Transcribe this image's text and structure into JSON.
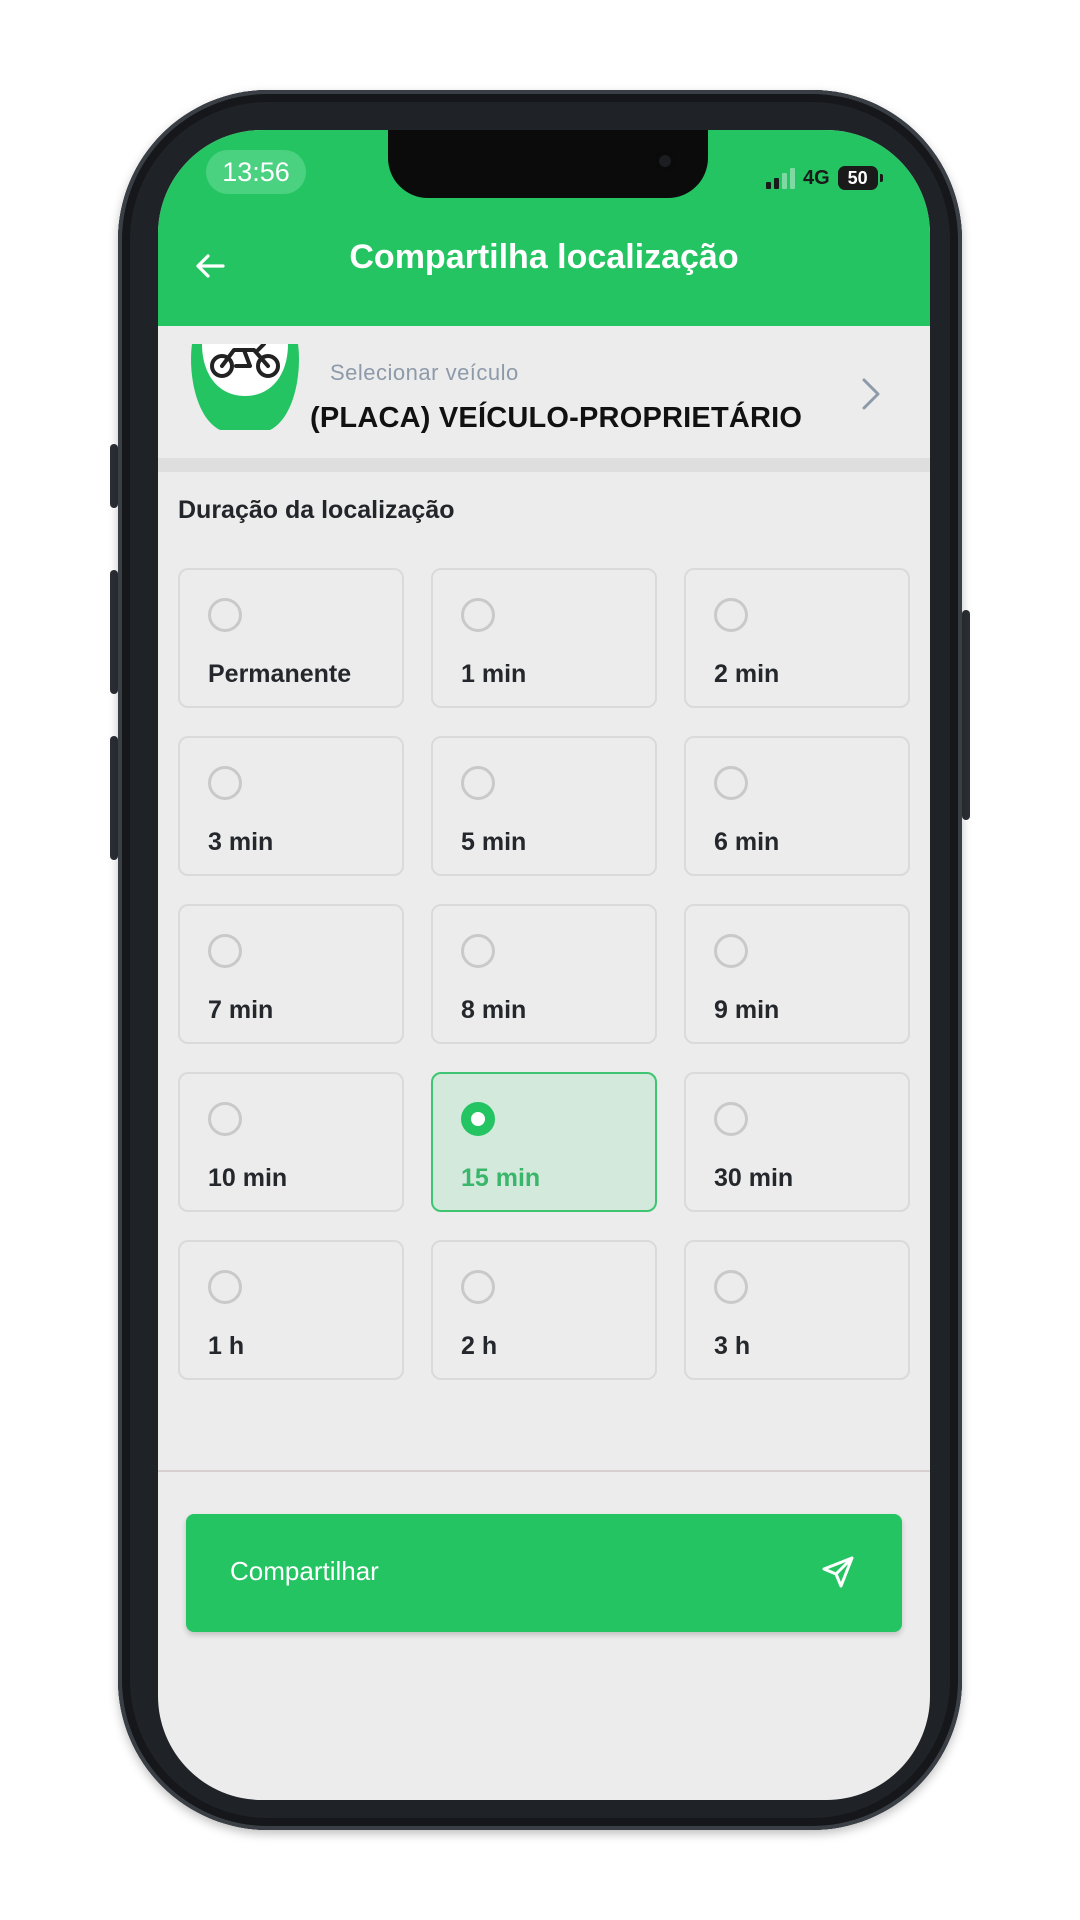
{
  "status_bar": {
    "time": "13:56",
    "network": "4G",
    "battery": "50"
  },
  "header": {
    "title": "Compartilha localização",
    "back_icon": "arrow-left-icon"
  },
  "vehicle": {
    "label": "Selecionar veículo",
    "name": "(PLACA) VEÍCULO-PROPRIETÁRIO",
    "icon": "motorcycle-icon",
    "chevron_icon": "chevron-right-icon"
  },
  "duration": {
    "title": "Duração da localização",
    "options": [
      {
        "label": "Permanente",
        "selected": false
      },
      {
        "label": "1 min",
        "selected": false
      },
      {
        "label": "2 min",
        "selected": false
      },
      {
        "label": "3 min",
        "selected": false
      },
      {
        "label": "5 min",
        "selected": false
      },
      {
        "label": "6 min",
        "selected": false
      },
      {
        "label": "7 min",
        "selected": false
      },
      {
        "label": "8 min",
        "selected": false
      },
      {
        "label": "9 min",
        "selected": false
      },
      {
        "label": "10 min",
        "selected": false
      },
      {
        "label": "15 min",
        "selected": true
      },
      {
        "label": "30 min",
        "selected": false
      },
      {
        "label": "1 h",
        "selected": false
      },
      {
        "label": "2 h",
        "selected": false
      },
      {
        "label": "3 h",
        "selected": false
      }
    ]
  },
  "share_button": {
    "label": "Compartilhar",
    "icon": "send-icon"
  },
  "colors": {
    "primary": "#25c462",
    "selected_bg": "#d2e9dc",
    "background": "#ececec"
  }
}
